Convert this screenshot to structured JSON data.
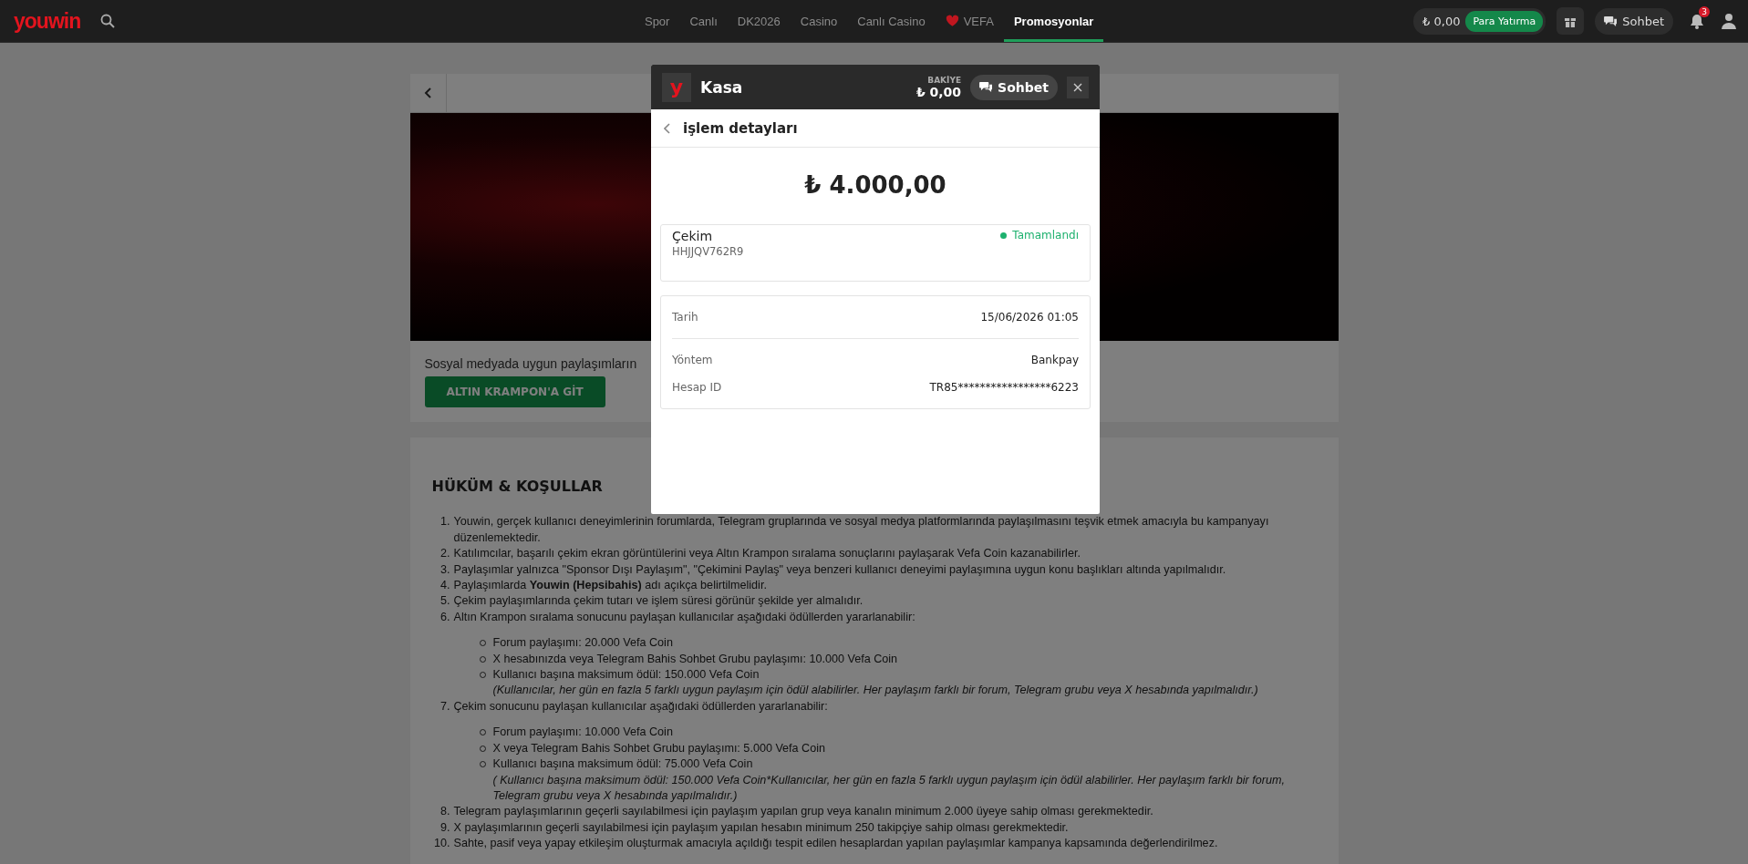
{
  "nav": {
    "logo": "youwin",
    "links": [
      {
        "label": "Spor",
        "kind": "text",
        "selected": false
      },
      {
        "label": "Canlı",
        "kind": "text",
        "selected": false
      },
      {
        "label": "DK2026",
        "kind": "text",
        "selected": false
      },
      {
        "label": "Casino",
        "kind": "text",
        "selected": false
      },
      {
        "label": "Canlı Casino",
        "kind": "text",
        "selected": false
      },
      {
        "label": "VEFA",
        "kind": "heart",
        "selected": false
      },
      {
        "label": "Promosyonlar",
        "kind": "text",
        "selected": true
      }
    ],
    "balance": "₺ 0,00",
    "deposit": "Para Yatırma",
    "chat": "Sohbet",
    "notifications": "3"
  },
  "promo": {
    "text": "Sosyal medyada uygun paylaşımların",
    "button": "ALTIN KRAMPON'A GİT"
  },
  "terms": {
    "title": "HÜKÜM & KOŞULLAR",
    "items": [
      {
        "number": "1.",
        "text": "Youwin, gerçek kullanıcı deneyimlerinin forumlarda, Telegram gruplarında ve sosyal medya platformlarında paylaşılmasını teşvik etmek amacıyla bu kampanyayı düzenlemektedir."
      },
      {
        "number": "2.",
        "text": "Katılımcılar, başarılı çekim ekran görüntülerini veya Altın Krampon sıralama sonuçlarını paylaşarak Vefa Coin kazanabilirler."
      },
      {
        "number": "3.",
        "text": "Paylaşımlar yalnızca \"Sponsor Dışı Paylaşım\", \"Çekimini Paylaş\" veya benzeri kullanıcı deneyimi paylaşımına uygun konu başlıkları altında yapılmalıdır."
      },
      {
        "number": "4.",
        "text": "Paylaşımlarda **Youwin (Hepsibahis)** adı açıkça belirtilmelidir."
      },
      {
        "number": "5.",
        "text": "Çekim paylaşımlarında çekim tutarı ve işlem süresi görünür şekilde yer almalıdır."
      },
      {
        "number": "6.",
        "text": "Altın Krampon sıralama sonucunu paylaşan kullanıcılar aşağıdaki ödüllerden yararlanabilir:",
        "sub": [
          "Forum paylaşımı: 20.000 Vefa Coin",
          "X hesabınızda veya Telegram Bahis Sohbet Grubu paylaşımı: 10.000 Vefa Coin",
          "Kullanıcı başına maksimum ödül: 150.000 Vefa Coin"
        ],
        "note": "(Kullanıcılar, her gün en fazla 5 farklı uygun paylaşım için ödül alabilirler. Her paylaşım farklı bir forum, Telegram grubu veya X hesabında yapılmalıdır.)"
      },
      {
        "number": "7.",
        "text": "Çekim sonucunu paylaşan kullanıcılar aşağıdaki ödüllerden yararlanabilir:",
        "sub": [
          "Forum paylaşımı: 10.000 Vefa Coin",
          "X veya Telegram Bahis Sohbet Grubu paylaşımı: 5.000 Vefa Coin",
          "Kullanıcı başına maksimum ödül: 75.000 Vefa Coin"
        ],
        "note": "( Kullanıcı başına maksimum ödül: 150.000 Vefa Coin*Kullanıcılar, her gün en fazla 5 farklı uygun paylaşım için ödül alabilirler. Her paylaşım farklı bir forum, Telegram grubu veya X hesabında yapılmalıdır.)"
      },
      {
        "number": "8.",
        "text": "Telegram paylaşımlarının geçerli sayılabilmesi için paylaşım yapılan grup veya kanalın minimum 2.000 üyeye sahip olması gerekmektedir."
      },
      {
        "number": "9.",
        "text": "X paylaşımlarının geçerli sayılabilmesi için paylaşım yapılan hesabın minimum 250 takipçiye sahip olması gerekmektedir."
      },
      {
        "number": "10.",
        "text": "Sahte, pasif veya yapay etkileşim oluşturmak amacıyla açıldığı tespit edilen hesaplardan yapılan paylaşımlar kampanya kapsamında değerlendirilmez."
      }
    ]
  },
  "modal": {
    "logo": "y",
    "title": "Kasa",
    "balance_label": "BAKİYE",
    "balance": "₺ 0,00",
    "chat": "Sohbet",
    "subtitle": "işlem detayları",
    "amount": "₺ 4.000,00",
    "transaction": {
      "type": "Çekim",
      "id": "HHJJQV762R9",
      "status": "Tamamlandı",
      "color": "#1db16e"
    },
    "sections": [
      [
        {
          "label": "Tarih",
          "value": "15/06/2026 01:05"
        }
      ],
      [
        {
          "label": "Yöntem",
          "value": "Bankpay"
        },
        {
          "label": "Hesap ID",
          "value": "TR85*****************6223"
        }
      ]
    ]
  }
}
